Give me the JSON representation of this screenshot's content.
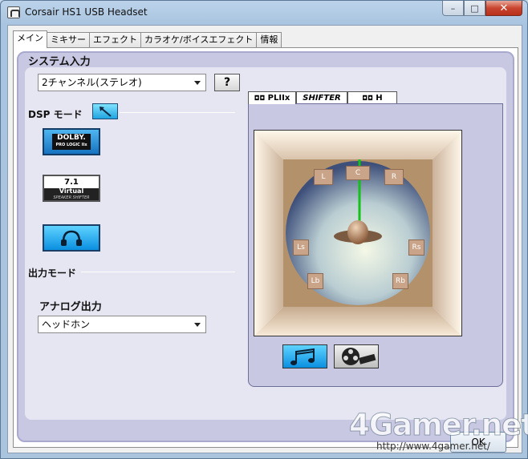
{
  "window": {
    "title": "Corsair HS1 USB Headset",
    "close_glyph": "✕",
    "max_glyph": "□",
    "min_glyph": "–"
  },
  "tabs": [
    {
      "label": "メイン",
      "active": true
    },
    {
      "label": "ミキサー"
    },
    {
      "label": "エフェクト"
    },
    {
      "label": "カラオケ/ボイスエフェクト"
    },
    {
      "label": "情報"
    }
  ],
  "system_input": {
    "heading": "システム入力",
    "selected": "2チャンネル(ステレオ)",
    "help_label": "?"
  },
  "dsp_mode": {
    "heading": "DSP モード",
    "dolby": {
      "brand": "DOLBY.",
      "sub": "PRO LOGIC IIx"
    },
    "virtual": {
      "line1": "7.1",
      "line2": "Virtual",
      "line3": "SPEAKER SHIFTER"
    }
  },
  "output_mode": {
    "heading": "出力モード",
    "analog_heading": "アナログ出力",
    "selected": "ヘッドホン"
  },
  "right_tabs": [
    "PLIIx",
    "SHIFTER",
    "H"
  ],
  "speakers": [
    "L",
    "C",
    "R",
    "Ls",
    "Rs",
    "Lb",
    "Rb"
  ],
  "footer": {
    "ok_label": "OK"
  },
  "watermark": {
    "logo": "4Gamer.net",
    "url": "http://www.4gamer.net/"
  },
  "colors": {
    "accent": "#0a8fe0",
    "panel": "#c8c8e2",
    "floor": "#b3926b"
  }
}
